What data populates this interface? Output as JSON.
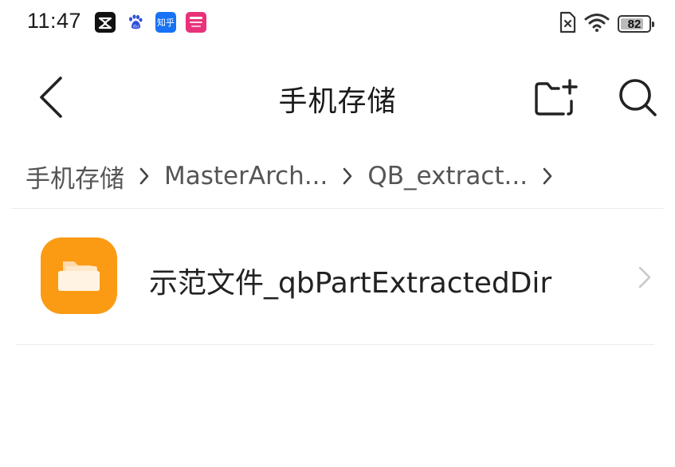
{
  "status_bar": {
    "time": "11:47",
    "battery": "82",
    "battery_level": 0.82,
    "apps": [
      {
        "name": "capcut-icon",
        "label": ""
      },
      {
        "name": "baidu-icon",
        "label": ""
      },
      {
        "name": "zhihu-icon",
        "label": "知乎"
      },
      {
        "name": "pink-app-icon",
        "label": ""
      }
    ]
  },
  "header": {
    "title": "手机存储"
  },
  "breadcrumb": [
    {
      "label": "手机存储"
    },
    {
      "label": "MasterArch..."
    },
    {
      "label": "QB_extract..."
    }
  ],
  "files": [
    {
      "name": "示范文件_qbPartExtractedDir",
      "type": "folder"
    }
  ],
  "colors": {
    "folder_accent": "#fb9b14",
    "divider": "#ececec"
  }
}
